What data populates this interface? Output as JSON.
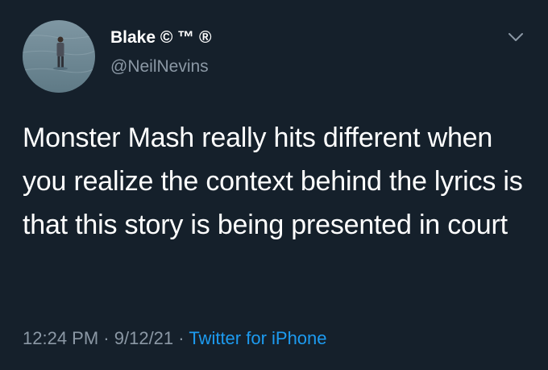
{
  "user": {
    "display_name": "Blake © ™ ®",
    "handle": "@NeilNevins"
  },
  "tweet": {
    "text": "Monster Mash really hits different when you realize the context behind the lyrics is that this story is being presented in court",
    "time": "12:24 PM",
    "date": "9/12/21",
    "separator": "·",
    "source": "Twitter for iPhone"
  },
  "icons": {
    "menu": "chevron-down-icon"
  },
  "colors": {
    "background": "#15202b",
    "primary_text": "#ffffff",
    "secondary_text": "#8b98a5",
    "link": "#1d9bf0"
  }
}
